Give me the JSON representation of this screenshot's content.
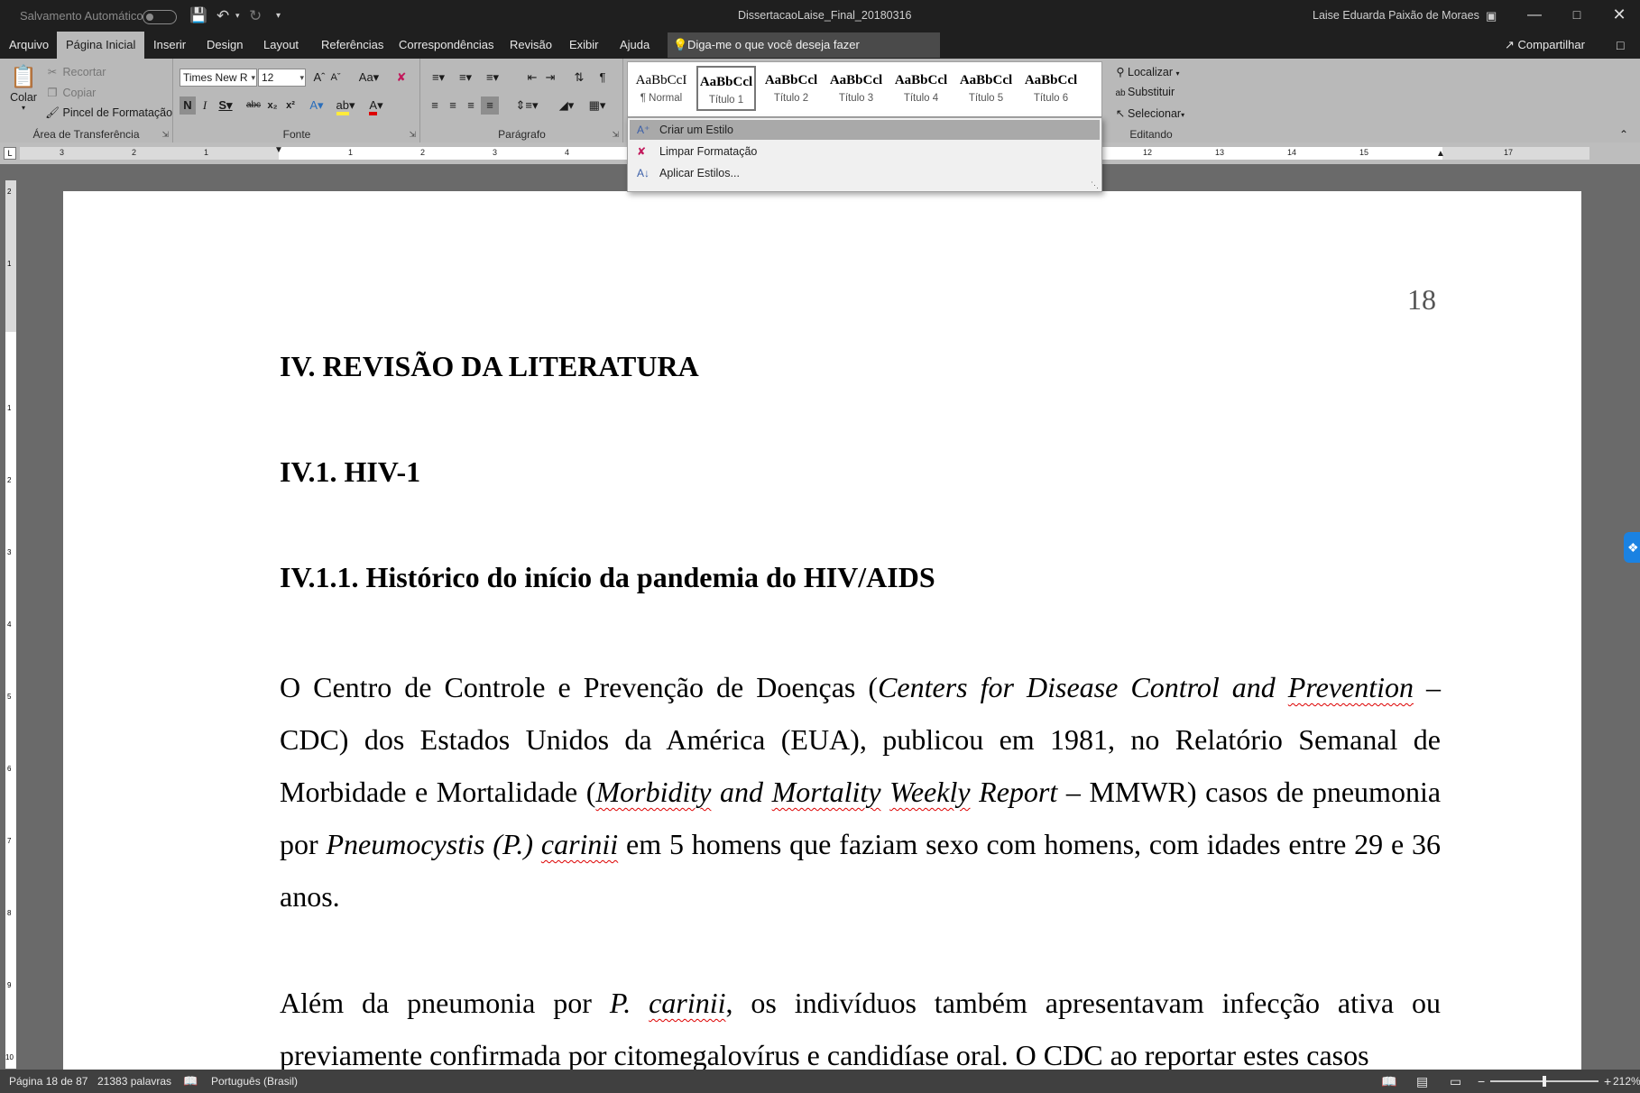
{
  "titlebar": {
    "autosave_label": "Salvamento Automático",
    "doc_title": "DissertacaoLaise_Final_20180316",
    "user_name": "Laise Eduarda Paixão de Moraes"
  },
  "menu": {
    "tabs": [
      "Arquivo",
      "Página Inicial",
      "Inserir",
      "Design",
      "Layout",
      "Referências",
      "Correspondências",
      "Revisão",
      "Exibir",
      "Ajuda"
    ],
    "active_tab": "Página Inicial",
    "tell_me": "Diga-me o que você deseja fazer",
    "share": "Compartilhar"
  },
  "clipboard": {
    "paste": "Colar",
    "cut": "Recortar",
    "copy": "Copiar",
    "format_painter": "Pincel de Formatação",
    "label": "Área de Transferência"
  },
  "font": {
    "name": "Times New R",
    "size": "12",
    "label": "Fonte"
  },
  "paragraph": {
    "label": "Parágrafo"
  },
  "styles": {
    "sample_text": "AaBbCcI",
    "items": [
      "¶ Normal",
      "Título 1",
      "Título 2",
      "Título 3",
      "Título 4",
      "Título 5",
      "Título 6"
    ],
    "samples": [
      "AaBbCcI",
      "AaBbCcl",
      "AaBbCcl",
      "AaBbCcl",
      "AaBbCcl",
      "AaBbCcl",
      "AaBbCcl"
    ],
    "selected": "Título 1",
    "menu": [
      "Criar um Estilo",
      "Limpar Formatação",
      "Aplicar Estilos..."
    ]
  },
  "editing": {
    "find": "Localizar",
    "replace": "Substituir",
    "select": "Selecionar",
    "label": "Editando"
  },
  "ruler": {
    "h_ticks": [
      "3",
      "2",
      "1",
      "1",
      "2",
      "3",
      "4",
      "12",
      "13",
      "14",
      "15",
      "17"
    ],
    "v_ticks": [
      "2",
      "1",
      "1",
      "2",
      "3",
      "4",
      "5",
      "6",
      "7",
      "8",
      "9",
      "10"
    ]
  },
  "document": {
    "page_number": "18",
    "h1": "IV. REVISÃO DA LITERATURA",
    "h2": "IV.1. HIV-1",
    "h3": "IV.1.1. Histórico do início da pandemia do HIV/AIDS",
    "p1": {
      "a": "O Centro de Controle e Prevenção de Doenças (",
      "b": "Centers for Disease Control and ",
      "c": "Prevention",
      "d": " – CDC) dos Estados Unidos da América (EUA), publicou em 1981, no Relatório Semanal de Morbidade e Mortalidade (",
      "e": "Morbidity",
      "f": " and ",
      "g": "Mortality",
      "h": " ",
      "i": "Weekly",
      "j": " Report",
      "k": " – MMWR) casos de pneumonia por ",
      "l": "Pneumocystis (P.) ",
      "m": "carinii",
      "n": " em 5 homens que faziam sexo com homens, com idades entre 29 e 36 anos."
    },
    "p2": {
      "a": "Além da pneumonia por ",
      "b": "P. ",
      "c": "carinii",
      "d": ", os indivíduos também apresentavam infecção ativa ou previamente confirmada por citomegalovírus e candidíase oral. O CDC ao reportar estes casos"
    }
  },
  "status": {
    "page": "Página 18 de 87",
    "words": "21383 palavras",
    "language": "Português (Brasil)",
    "zoom": "212%"
  },
  "colors": {
    "title_bg": "#1f1f1f",
    "ribbon_bg": "#b9b9b9",
    "status_bg": "#404040",
    "spell_underline": "#d00000"
  }
}
